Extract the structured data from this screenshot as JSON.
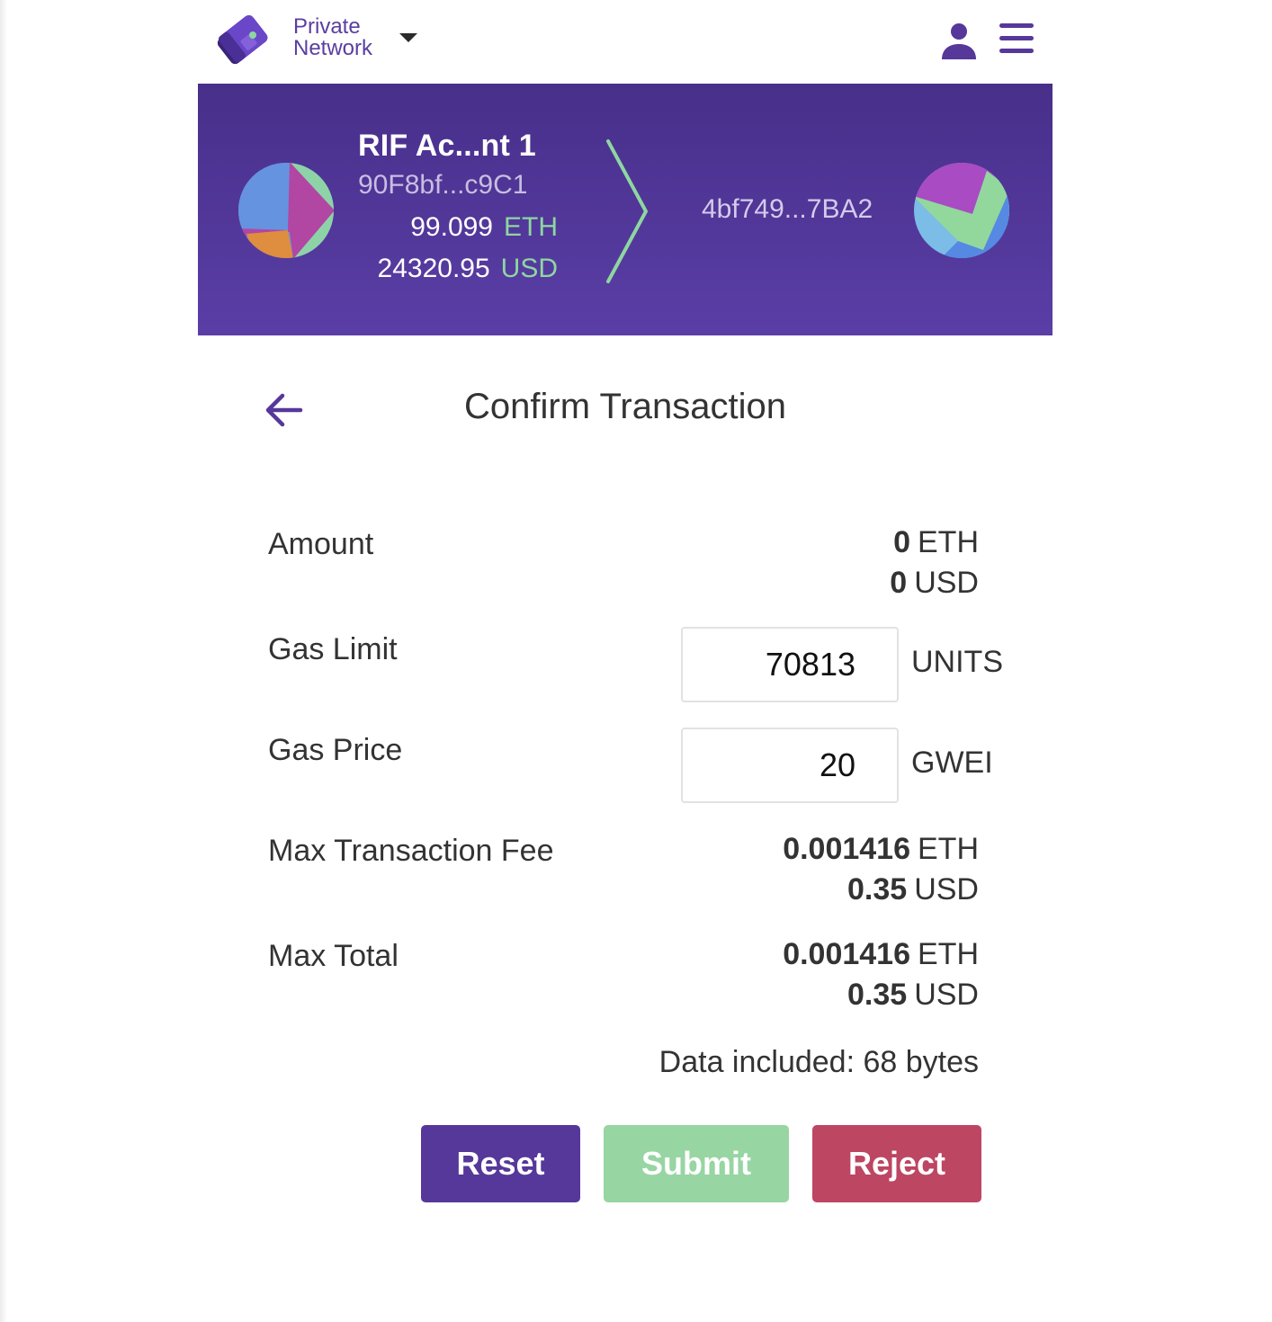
{
  "topbar": {
    "network_line1": "Private",
    "network_line2": "Network",
    "icons": {
      "logo": "wallet-logo-icon",
      "dropdown": "caret-down-icon",
      "user": "user-icon",
      "menu": "hamburger-menu-icon"
    }
  },
  "header": {
    "from": {
      "account_name": "RIF Ac...nt 1",
      "address": "90F8bf...c9C1",
      "eth_balance": "99.099",
      "eth_unit": "ETH",
      "usd_balance": "24320.95",
      "usd_unit": "USD"
    },
    "to": {
      "address": "4bf749...7BA2"
    },
    "colors": {
      "accent_green": "#8ed6a1",
      "band_top": "#482f8a",
      "band_bottom": "#5a3ea6"
    }
  },
  "page": {
    "title": "Confirm Transaction",
    "back_icon": "arrow-left-icon"
  },
  "details": {
    "amount": {
      "label": "Amount",
      "eth_value": "0",
      "eth_unit": "ETH",
      "usd_value": "0",
      "usd_unit": "USD"
    },
    "gas_limit": {
      "label": "Gas Limit",
      "value": "70813",
      "unit": "UNITS"
    },
    "gas_price": {
      "label": "Gas Price",
      "value": "20",
      "unit": "GWEI"
    },
    "max_fee": {
      "label": "Max Transaction Fee",
      "eth_value": "0.001416",
      "eth_unit": "ETH",
      "usd_value": "0.35",
      "usd_unit": "USD"
    },
    "max_total": {
      "label": "Max Total",
      "eth_value": "0.001416",
      "eth_unit": "ETH",
      "usd_value": "0.35",
      "usd_unit": "USD"
    },
    "data_included": "Data included: 68 bytes"
  },
  "actions": {
    "reset_label": "Reset",
    "submit_label": "Submit",
    "reject_label": "Reject",
    "colors": {
      "reset": "#56379a",
      "submit": "#97d5a2",
      "reject": "#bd4663"
    }
  }
}
